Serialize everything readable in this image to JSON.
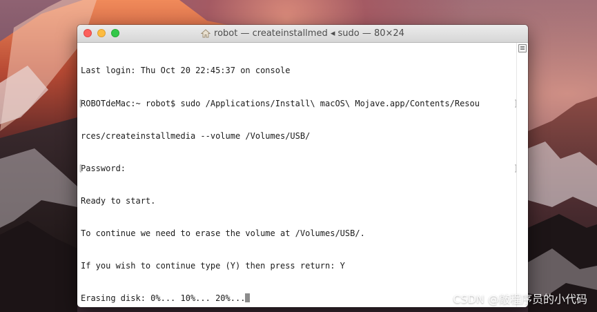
{
  "window": {
    "title": "robot — createinstallmed ◂ sudo — 80×24",
    "title_icon": "home-folder-icon",
    "buttons": [
      "close",
      "minimize",
      "zoom"
    ]
  },
  "terminal": {
    "lines": [
      "Last login: Thu Oct 20 22:45:37 on console",
      "ROBOTdeMac:~ robot$ sudo /Applications/Install\\ macOS\\ Mojave.app/Contents/Resou",
      "rces/createinstallmedia --volume /Volumes/USB/",
      "Password:",
      "Ready to start.",
      "To continue we need to erase the volume at /Volumes/USB/.",
      "If you wish to continue type (Y) then press return: Y",
      "Erasing disk: 0%... 10%... 20%..."
    ]
  },
  "watermark": "CSDN @敲程序员的小代码",
  "colors": {
    "close": "#fc605c",
    "minimize": "#fdbc40",
    "zoom": "#34c84a",
    "terminal_bg": "#ffffff",
    "terminal_text": "#1a1a1a"
  }
}
